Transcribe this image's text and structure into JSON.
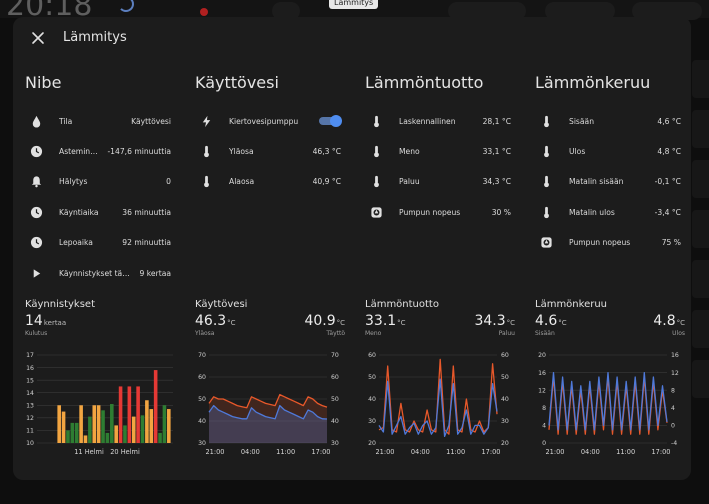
{
  "background": {
    "clock": "20:18",
    "tooltip": "Lämmitys"
  },
  "dialog": {
    "title": "Lämmitys"
  },
  "columns": [
    {
      "title": "Nibe",
      "rows": [
        {
          "icon": "water-drop-icon",
          "label": "Tila",
          "value": "Käyttövesi"
        },
        {
          "icon": "clock-icon",
          "label": "Asteminuu...",
          "value": "-147,6 minuuttia"
        },
        {
          "icon": "bell-icon",
          "label": "Hälytys",
          "value": "0"
        },
        {
          "icon": "clock-icon",
          "label": "Käyntiaika",
          "value": "36 minuuttia"
        },
        {
          "icon": "clock-icon",
          "label": "Lepoaika",
          "value": "92 minuuttia"
        },
        {
          "icon": "play-icon",
          "label": "Käynnistykset tänä...",
          "value": "9 kertaa"
        }
      ]
    },
    {
      "title": "Käyttövesi",
      "rows": [
        {
          "icon": "lightning-icon",
          "label": "Kiertovesipumppu",
          "toggle": true
        },
        {
          "icon": "thermometer-icon",
          "label": "Yläosa",
          "value": "46,3 °C"
        },
        {
          "icon": "thermometer-icon",
          "label": "Alaosa",
          "value": "40,9 °C"
        }
      ]
    },
    {
      "title": "Lämmöntuotto",
      "rows": [
        {
          "icon": "thermometer-icon",
          "label": "Laskennallinen",
          "value": "28,1 °C"
        },
        {
          "icon": "thermometer-icon",
          "label": "Meno",
          "value": "33,1 °C"
        },
        {
          "icon": "thermometer-icon",
          "label": "Paluu",
          "value": "34,3 °C"
        },
        {
          "icon": "pump-icon",
          "label": "Pumpun nopeus",
          "value": "30 %"
        }
      ]
    },
    {
      "title": "Lämmönkeruu",
      "rows": [
        {
          "icon": "thermometer-icon",
          "label": "Sisään",
          "value": "4,6 °C"
        },
        {
          "icon": "thermometer-icon",
          "label": "Ulos",
          "value": "4,8 °C"
        },
        {
          "icon": "thermometer-icon",
          "label": "Matalin sisään",
          "value": "-0,1 °C"
        },
        {
          "icon": "thermometer-icon",
          "label": "Matalin ulos",
          "value": "-3,4 °C"
        },
        {
          "icon": "pump-icon",
          "label": "Pumpun nopeus",
          "value": "75 %"
        }
      ]
    }
  ],
  "cards": [
    {
      "title": "Käynnistykset",
      "primary": {
        "value": "14",
        "unit": "kertaa",
        "label": "Kulutus"
      }
    },
    {
      "title": "Käyttövesi",
      "primary": {
        "value": "46.3",
        "unit": "°C",
        "label": "Yläosa"
      },
      "secondary": {
        "value": "40.9",
        "unit": "°C",
        "label": "Täyttö"
      }
    },
    {
      "title": "Lämmöntuotto",
      "primary": {
        "value": "33.1",
        "unit": "°C",
        "label": "Meno"
      },
      "secondary": {
        "value": "34.3",
        "unit": "°C",
        "label": "Paluu"
      }
    },
    {
      "title": "Lämmönkeruu",
      "primary": {
        "value": "4.6",
        "unit": "°C",
        "label": "Sisään"
      },
      "secondary": {
        "value": "4.8",
        "unit": "°C",
        "label": "Ulos"
      }
    }
  ],
  "chart_data": [
    {
      "type": "bar",
      "title": "Käynnistykset",
      "x_ticks": [
        "11 Helmi",
        "20 Helmi"
      ],
      "ylim": [
        10,
        17
      ],
      "y_ticks": [
        10,
        11,
        12,
        13,
        14,
        15,
        16,
        17
      ],
      "values": [
        13,
        12.5,
        11,
        11.6,
        11.6,
        13,
        10.6,
        12.1,
        13,
        13,
        12.6,
        10.8,
        13.1,
        11.4,
        14.5,
        11.4,
        14.5,
        12.1,
        14.5,
        12.2,
        13.4,
        12.7,
        15.8,
        10.8,
        13,
        12.7
      ],
      "colors": [
        "#f2a541",
        "#f2a541",
        "#2e7d32",
        "#2e7d32",
        "#2e7d32",
        "#f2a541",
        "#f2a541",
        "#2e7d32",
        "#f2a541",
        "#f2a541",
        "#2e7d32",
        "#2e7d32",
        "#2e7d32",
        "#f2a541",
        "#e53935",
        "#2e7d32",
        "#e53935",
        "#f2a541",
        "#e53935",
        "#2e7d32",
        "#f2a541",
        "#f2a541",
        "#e53935",
        "#2e7d32",
        "#2e7d32",
        "#f2a541"
      ]
    },
    {
      "type": "area",
      "title": "Käyttövesi",
      "x_ticks": [
        "21:00",
        "04:00",
        "11:00",
        "17:00"
      ],
      "ylim": [
        30,
        70
      ],
      "y_ticks": [
        30,
        40,
        50,
        60,
        70
      ],
      "series": [
        {
          "name": "Yläosa",
          "color": "#e8582a",
          "values": [
            48,
            51,
            50,
            50,
            49,
            48,
            47,
            46.5,
            46,
            51,
            50,
            49,
            48,
            47.5,
            47,
            52,
            51,
            50,
            49,
            48,
            47,
            51,
            50,
            48,
            47,
            46.3
          ]
        },
        {
          "name": "Täyttö",
          "color": "#4f79d9",
          "values": [
            44,
            47,
            45,
            44,
            43,
            42,
            41.5,
            41,
            41,
            46,
            44,
            43,
            42,
            41.5,
            41,
            47,
            45,
            44,
            43,
            42,
            41,
            45,
            44,
            42,
            41,
            40.9
          ]
        }
      ]
    },
    {
      "type": "line",
      "title": "Lämmöntuotto",
      "x_ticks": [
        "21:00",
        "04:00",
        "11:00",
        "17:00"
      ],
      "ylim": [
        20,
        60
      ],
      "y_ticks": [
        20,
        30,
        40,
        50,
        60
      ],
      "series": [
        {
          "name": "Meno",
          "color": "#e8582a",
          "values": [
            26,
            27,
            55,
            26,
            25,
            38,
            26,
            25,
            30,
            26,
            25,
            35,
            26,
            25,
            58,
            26,
            24,
            55,
            26,
            25,
            40,
            26,
            25,
            30,
            25,
            27,
            56,
            33.1
          ]
        },
        {
          "name": "Paluu",
          "color": "#4f79d9",
          "values": [
            28,
            25,
            48,
            24,
            28,
            32,
            24,
            27,
            29,
            24,
            28,
            30,
            24,
            27,
            49,
            23,
            28,
            47,
            24,
            27,
            35,
            24,
            28,
            28,
            24,
            27,
            47,
            34.3
          ]
        }
      ]
    },
    {
      "type": "line",
      "title": "Lämmönkeruu",
      "x_ticks": [
        "21:00",
        "04:00",
        "11:00",
        "17:00"
      ],
      "ylim": [
        0,
        20
      ],
      "y_ticks": [
        0,
        4,
        8,
        12,
        16,
        20
      ],
      "right_ticks": [
        -4,
        0,
        4,
        8,
        12,
        16
      ],
      "series": [
        {
          "name": "Sisään",
          "color": "#e8582a",
          "values": [
            3,
            15,
            2,
            14,
            2,
            13,
            2,
            12,
            2,
            13,
            2,
            14,
            3,
            15,
            2,
            14,
            2,
            13,
            2,
            14,
            2,
            15,
            2,
            14,
            3,
            12,
            4.6
          ]
        },
        {
          "name": "Ulos",
          "color": "#4f79d9",
          "values": [
            4,
            16,
            3,
            15,
            3,
            14,
            3,
            13,
            3,
            14,
            3,
            15,
            4,
            16,
            3,
            15,
            3,
            14,
            3,
            15,
            3,
            16,
            3,
            15,
            4,
            13,
            4.8
          ]
        }
      ]
    }
  ]
}
